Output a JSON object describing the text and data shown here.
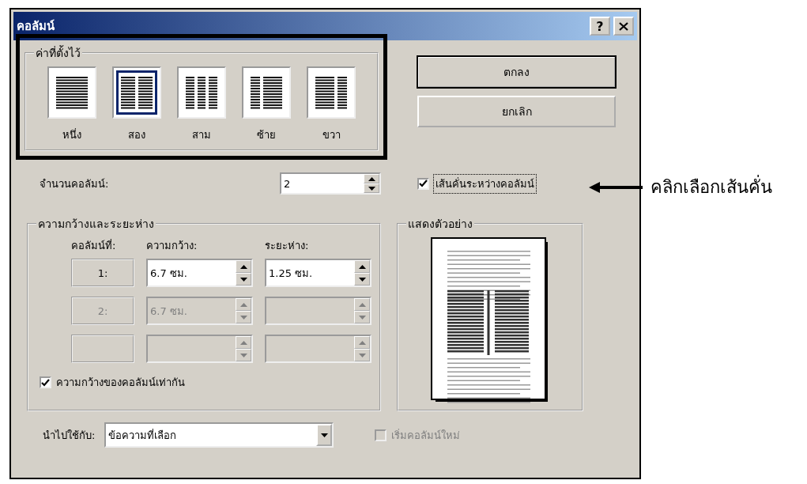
{
  "window": {
    "title": "คอลัมน์",
    "help_button": "?"
  },
  "presets": {
    "label": "ค่าที่ตั้งไว้",
    "items": [
      {
        "kind": "one",
        "label": "หนึ่ง",
        "selected": false
      },
      {
        "kind": "two",
        "label": "สอง",
        "selected": true
      },
      {
        "kind": "three",
        "label": "สาม",
        "selected": false
      },
      {
        "kind": "left",
        "label": "ซ้าย",
        "selected": false
      },
      {
        "kind": "right",
        "label": "ขวา",
        "selected": false
      }
    ]
  },
  "buttons": [
    {
      "label": "ตกลง",
      "default": true
    },
    {
      "label": "ยกเลิก",
      "default": false
    }
  ],
  "number_of_columns": {
    "label": "จำนวนคอลัมน์:",
    "value": "2"
  },
  "line_between": {
    "label": "เส้นคั่นระหว่างคอลัมน์",
    "checked": true
  },
  "width_spacing": {
    "label": "ความกว้างและระยะห่าง",
    "headers": [
      "คอลัมน์ที่:",
      "ความกว้าง:",
      "ระยะห่าง:"
    ],
    "rows": [
      {
        "number": "1:",
        "width": "6.7 ซม.",
        "spacing": "1.25 ซม.",
        "disabled": false
      },
      {
        "number": "2:",
        "width": "6.7 ซม.",
        "disabled": true
      },
      {
        "disabled": true
      }
    ],
    "equal_width": {
      "label": "ความกว้างของคอลัมน์เท่ากัน",
      "checked": true
    }
  },
  "preview": {
    "label": "แสดงตัวอย่าง"
  },
  "apply_to": {
    "label": "นำไปใช้กับ:",
    "value": "ข้อความที่เลือก"
  },
  "start_new_column": {
    "label": "เริ่มคอลัมน์ใหม่",
    "checked": false,
    "disabled": true
  },
  "annotation": {
    "text": "คลิกเลือกเส้นคั่น"
  }
}
